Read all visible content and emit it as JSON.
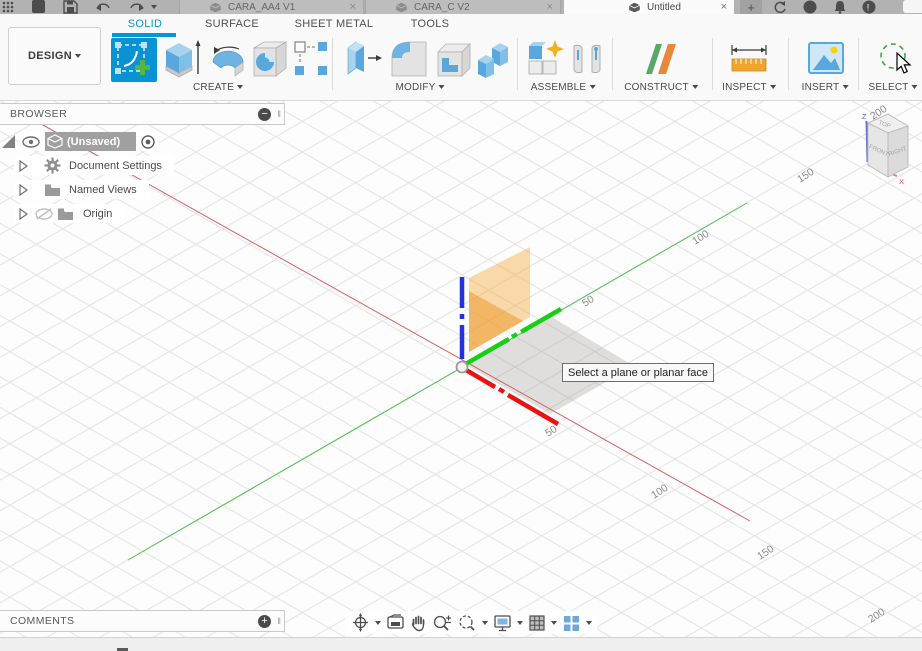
{
  "titlebar": {
    "tabs": [
      {
        "label": "CARA_AA4 V1",
        "close": "×"
      },
      {
        "label": "CARA_C V2",
        "close": "×"
      },
      {
        "label": "Untitled",
        "close": "×"
      }
    ],
    "new_tab": "+"
  },
  "ribbon": {
    "design_label": "DESIGN",
    "tabs": {
      "solid": "SOLID",
      "surface": "SURFACE",
      "sheetmetal": "SHEET METAL",
      "tools": "TOOLS"
    },
    "active_tab": "SOLID",
    "accent_color": "#0696d7",
    "groups": {
      "create": "CREATE",
      "modify": "MODIFY",
      "assemble": "ASSEMBLE",
      "construct": "CONSTRUCT",
      "inspect": "INSPECT",
      "insert": "INSERT",
      "select": "SELECT"
    }
  },
  "browser": {
    "title": "BROWSER",
    "collapse_glyph": "−",
    "root_label": "(Unsaved)",
    "items": [
      {
        "label": "Document Settings"
      },
      {
        "label": "Named Views"
      },
      {
        "label": "Origin"
      }
    ]
  },
  "comments": {
    "title": "COMMENTS",
    "add_glyph": "+"
  },
  "tooltip_text": "Select a plane or planar face",
  "viewcube": {
    "top": "TOP",
    "front": "FRONT",
    "right": "RIGHT",
    "z": "Z",
    "x": "X"
  },
  "axis_labels": {
    "green": [
      "50",
      "100",
      "150",
      "200"
    ],
    "red": [
      "50",
      "100",
      "150",
      "200"
    ]
  },
  "colors": {
    "x_axis": "#ee1111",
    "y_axis": "#17cf17",
    "z_axis": "#2233dd",
    "plane_highlight": "#f4a635",
    "grid": "#e3e3e3"
  }
}
